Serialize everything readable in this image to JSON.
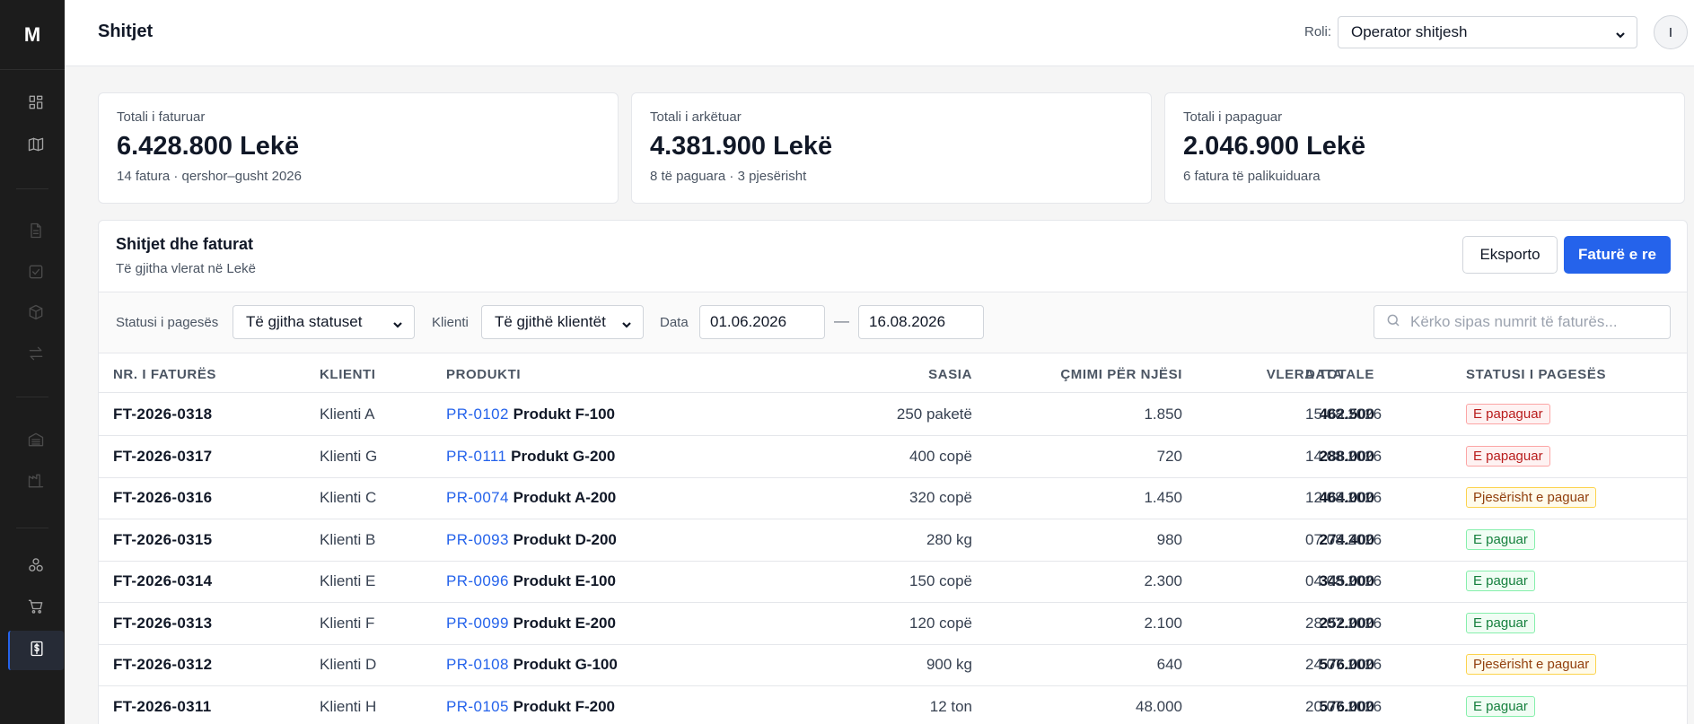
{
  "app": {
    "logo": "M"
  },
  "header": {
    "title": "Shitjet",
    "role_label": "Roli:",
    "role_value": "Operator shitjesh",
    "avatar_initial": "I"
  },
  "sidebar": {
    "items": [
      {
        "icon": "dashboard-icon"
      },
      {
        "icon": "map-icon"
      },
      {
        "icon": "document-icon"
      },
      {
        "icon": "checkbox-icon"
      },
      {
        "icon": "box-icon"
      },
      {
        "icon": "transfer-icon"
      },
      {
        "icon": "warehouse-icon"
      },
      {
        "icon": "factory-icon"
      },
      {
        "icon": "network-icon"
      },
      {
        "icon": "cart-icon"
      },
      {
        "icon": "dollar-invoice-icon",
        "active": true
      }
    ]
  },
  "kpis": [
    {
      "label": "Totali i faturuar",
      "value": "6.428.800 Lekë",
      "sub": "14 fatura · qershor–gusht 2026"
    },
    {
      "label": "Totali i arkëtuar",
      "value": "4.381.900 Lekë",
      "sub": "8 të paguara · 3 pjesërisht"
    },
    {
      "label": "Totali i papaguar",
      "value": "2.046.900 Lekë",
      "sub": "6 fatura të palikuiduara"
    }
  ],
  "panel": {
    "title": "Shitjet dhe faturat",
    "subtitle": "Të gjitha vlerat në Lekë",
    "export_label": "Eksporto",
    "new_label": "Faturë e re"
  },
  "filters": {
    "status_label": "Statusi i pagesës",
    "status_value": "Të gjitha statuset",
    "client_label": "Klienti",
    "client_value": "Të gjithë klientët",
    "date_label": "Data",
    "date_from": "01.06.2026",
    "date_sep": "—",
    "date_to": "16.08.2026",
    "search_placeholder": "Kërko sipas numrit të faturës..."
  },
  "table": {
    "columns": [
      "NR. I FATURËS",
      "KLIENTI",
      "PRODUKTI",
      "SASIA",
      "ÇMIMI PËR NJËSI",
      "VLERA TOTALE",
      "DATA",
      "STATUSI I PAGESËS"
    ],
    "rows": [
      {
        "invoice": "FT-2026-0318",
        "client": "Klienti A",
        "code": "PR-0102",
        "product": "Produkt F-100",
        "qty": "250 paketë",
        "price": "1.850",
        "total": "462.500",
        "date": "15.08.2026",
        "status": "E papaguar",
        "status_kind": "unpaid"
      },
      {
        "invoice": "FT-2026-0317",
        "client": "Klienti G",
        "code": "PR-0111",
        "product": "Produkt G-200",
        "qty": "400 copë",
        "price": "720",
        "total": "288.000",
        "date": "14.08.2026",
        "status": "E papaguar",
        "status_kind": "unpaid"
      },
      {
        "invoice": "FT-2026-0316",
        "client": "Klienti C",
        "code": "PR-0074",
        "product": "Produkt A-200",
        "qty": "320 copë",
        "price": "1.450",
        "total": "464.000",
        "date": "12.08.2026",
        "status": "Pjesërisht e paguar",
        "status_kind": "partial"
      },
      {
        "invoice": "FT-2026-0315",
        "client": "Klienti B",
        "code": "PR-0093",
        "product": "Produkt D-200",
        "qty": "280 kg",
        "price": "980",
        "total": "274.400",
        "date": "07.08.2026",
        "status": "E paguar",
        "status_kind": "paid"
      },
      {
        "invoice": "FT-2026-0314",
        "client": "Klienti E",
        "code": "PR-0096",
        "product": "Produkt E-100",
        "qty": "150 copë",
        "price": "2.300",
        "total": "345.000",
        "date": "04.08.2026",
        "status": "E paguar",
        "status_kind": "paid"
      },
      {
        "invoice": "FT-2026-0313",
        "client": "Klienti F",
        "code": "PR-0099",
        "product": "Produkt E-200",
        "qty": "120 copë",
        "price": "2.100",
        "total": "252.000",
        "date": "28.07.2026",
        "status": "E paguar",
        "status_kind": "paid"
      },
      {
        "invoice": "FT-2026-0312",
        "client": "Klienti D",
        "code": "PR-0108",
        "product": "Produkt G-100",
        "qty": "900 kg",
        "price": "640",
        "total": "576.000",
        "date": "24.07.2026",
        "status": "Pjesërisht e paguar",
        "status_kind": "partial"
      },
      {
        "invoice": "FT-2026-0311",
        "client": "Klienti H",
        "code": "PR-0105",
        "product": "Produkt F-200",
        "qty": "12 ton",
        "price": "48.000",
        "total": "576.000",
        "date": "20.07.2026",
        "status": "E paguar",
        "status_kind": "paid"
      }
    ]
  },
  "colors": {
    "accent": "#2563eb",
    "sidebar": "#1c1c1c",
    "unpaid": "#b91c1c",
    "partial": "#92400e",
    "paid": "#15803d"
  }
}
